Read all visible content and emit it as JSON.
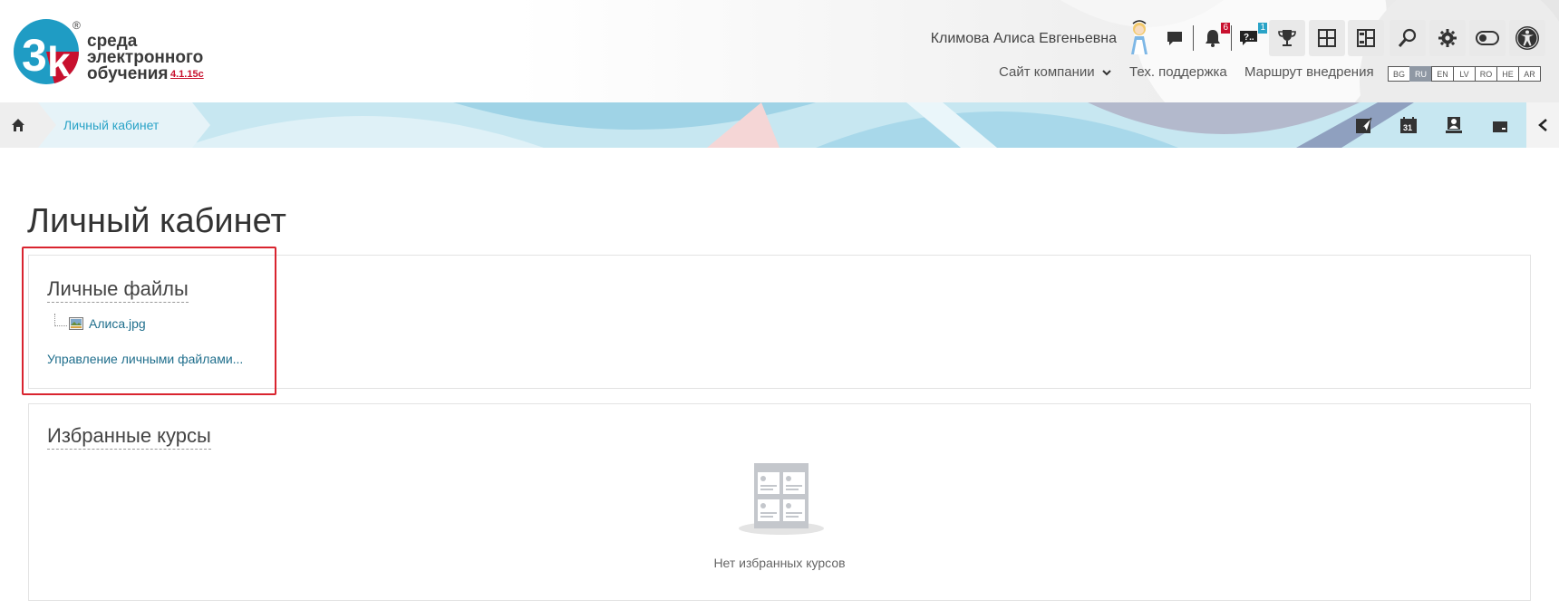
{
  "header": {
    "logo_text_lines": [
      "среда",
      "электронного",
      "обучения"
    ],
    "logo_version": "4.1.15c",
    "user_name": "Климова Алиса Евгеньевна",
    "notifications_count": "6",
    "questions_count": "1",
    "topnav": {
      "company_site": "Сайт компании",
      "support": "Тех. поддержка",
      "route": "Маршрут внедрения"
    },
    "languages": [
      "BG",
      "RU",
      "EN",
      "LV",
      "RO",
      "HE",
      "AR"
    ],
    "active_language": "RU"
  },
  "breadcrumb": {
    "current": "Личный кабинет"
  },
  "main": {
    "page_title": "Личный кабинет",
    "private_files": {
      "title": "Личные файлы",
      "files": [
        "Алиса.jpg"
      ],
      "manage_link": "Управление личными файлами..."
    },
    "starred_courses": {
      "title": "Избранные курсы",
      "empty_text": "Нет избранных курсов"
    }
  },
  "colors": {
    "accent": "#2aa3c7",
    "brand_red": "#c8102e",
    "highlight": "#d9242f",
    "link": "#1f6e8c"
  }
}
